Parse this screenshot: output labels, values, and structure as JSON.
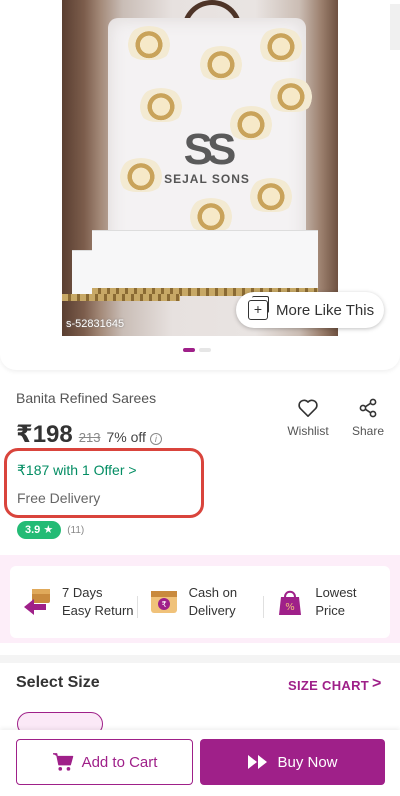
{
  "product_image": {
    "brand_watermark": "SEJAL SONS",
    "sku_label": "s-52831645",
    "more_like_label": "More Like This",
    "carousel_total": 2,
    "carousel_active": 1
  },
  "product": {
    "title": "Banita Refined Sarees",
    "price": "₹198",
    "mrp": "213",
    "discount": "7% off",
    "offer_text": "₹187 with 1 Offer >",
    "delivery_text": "Free Delivery",
    "rating": "3.9 ★",
    "rating_count": "(11)"
  },
  "actions": {
    "wishlist_label": "Wishlist",
    "share_label": "Share"
  },
  "benefits": [
    {
      "icon": "easy-return-icon",
      "line1": "7 Days",
      "line2": "Easy Return"
    },
    {
      "icon": "cash-on-delivery-icon",
      "line1": "Cash on",
      "line2": "Delivery"
    },
    {
      "icon": "lowest-price-icon",
      "line1": "Lowest",
      "line2": "Price"
    }
  ],
  "size": {
    "title": "Select Size",
    "chart_link": "SIZE CHART"
  },
  "bottom_bar": {
    "add_to_cart": "Add to Cart",
    "buy_now": "Buy Now"
  },
  "colors": {
    "brand": "#9f2089",
    "offer_green": "#038d63",
    "rating_green": "#23bb75",
    "highlight_red": "#d9443c",
    "benefits_bg": "#fdeef9"
  }
}
